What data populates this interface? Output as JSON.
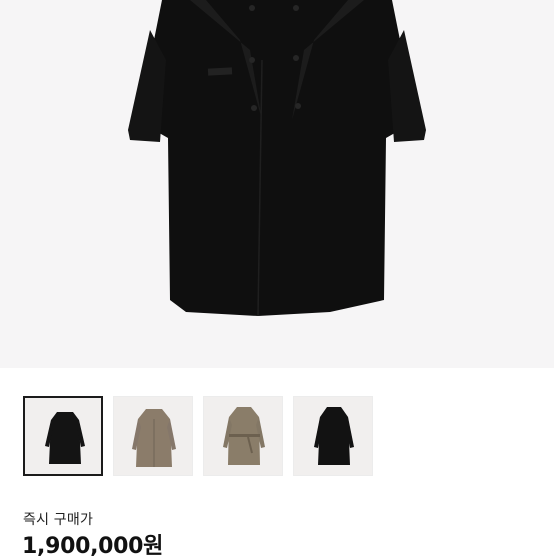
{
  "product": {
    "gallery": {
      "selected_index": 0,
      "thumbnails": [
        {
          "coat_color": "#141414",
          "style": "double-breasted"
        },
        {
          "coat_color": "#8b7c6a",
          "style": "double-breasted"
        },
        {
          "coat_color": "#8a7d69",
          "style": "belted"
        },
        {
          "coat_color": "#121212",
          "style": "single-breasted"
        }
      ]
    },
    "price_label": "즉시 구매가",
    "price": "1,900,000원"
  }
}
